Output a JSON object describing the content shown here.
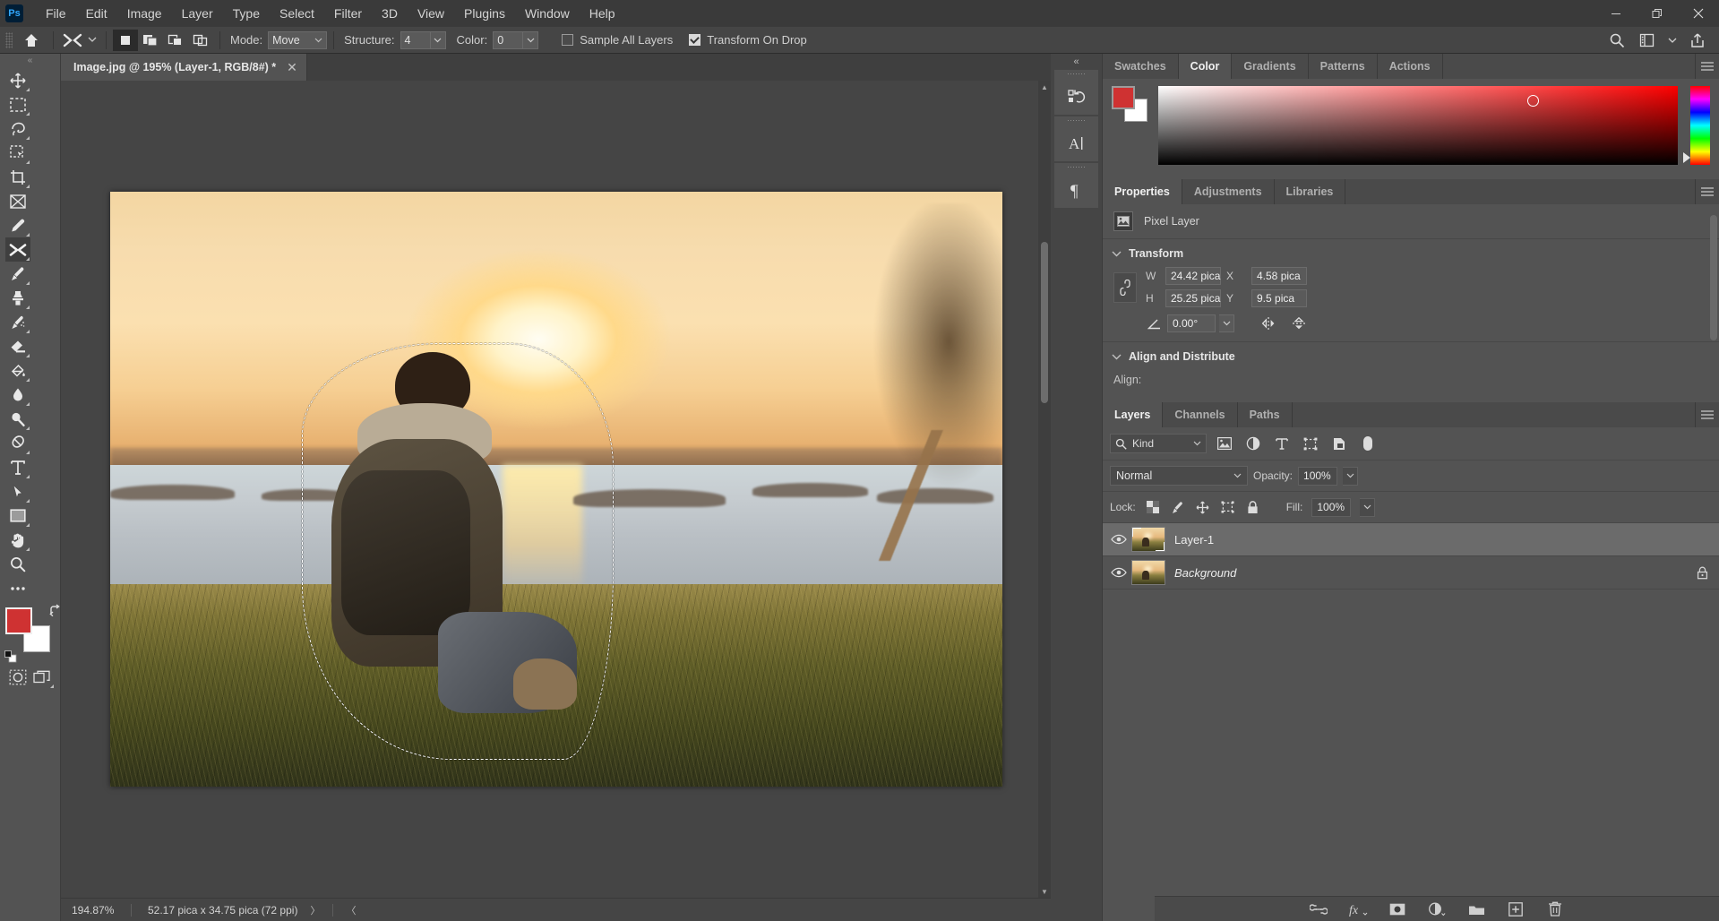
{
  "app": {
    "logo_text": "Ps",
    "menus": [
      "File",
      "Edit",
      "Image",
      "Layer",
      "Type",
      "Select",
      "Filter",
      "3D",
      "View",
      "Plugins",
      "Window",
      "Help"
    ],
    "window_controls": {
      "minimize": "minimize-icon",
      "maximize": "maximize-icon",
      "close": "close-icon"
    }
  },
  "options_bar": {
    "home_icon": "home-icon",
    "tool_icon": "shuffle-tool-icon",
    "selection_modes": [
      "new-selection",
      "add-to-selection",
      "subtract-from-selection",
      "intersect-selection"
    ],
    "mode_label": "Mode:",
    "mode_value": "Move",
    "structure_label": "Structure:",
    "structure_value": "4",
    "color_label": "Color:",
    "color_value": "0",
    "sample_all_layers_label": "Sample All Layers",
    "sample_all_layers_checked": false,
    "transform_on_drop_label": "Transform On Drop",
    "transform_on_drop_checked": true,
    "right_icons": [
      "search-icon",
      "workspace-icon",
      "chevron-down-icon",
      "share-icon"
    ]
  },
  "toolbar": {
    "tools": [
      {
        "name": "move-tool",
        "glyph": "move"
      },
      {
        "name": "rectangular-marquee-tool",
        "glyph": "marquee"
      },
      {
        "name": "lasso-tool",
        "glyph": "lasso"
      },
      {
        "name": "object-selection-tool",
        "glyph": "objsel"
      },
      {
        "name": "crop-tool",
        "glyph": "crop"
      },
      {
        "name": "frame-tool",
        "glyph": "frame"
      },
      {
        "name": "eyedropper-tool",
        "glyph": "eyedropper"
      },
      {
        "name": "content-aware-move-tool",
        "glyph": "shuffle",
        "active": true
      },
      {
        "name": "brush-tool",
        "glyph": "brush"
      },
      {
        "name": "clone-stamp-tool",
        "glyph": "stamp"
      },
      {
        "name": "history-brush-tool",
        "glyph": "historybrush"
      },
      {
        "name": "eraser-tool",
        "glyph": "eraser"
      },
      {
        "name": "gradient-tool",
        "glyph": "bucket"
      },
      {
        "name": "blur-tool",
        "glyph": "drop"
      },
      {
        "name": "dodge-tool",
        "glyph": "dodge"
      },
      {
        "name": "pen-tool",
        "glyph": "pen"
      },
      {
        "name": "horizontal-type-tool",
        "glyph": "type"
      },
      {
        "name": "path-selection-tool",
        "glyph": "arrow"
      },
      {
        "name": "rectangle-tool",
        "glyph": "rect"
      },
      {
        "name": "hand-tool",
        "glyph": "hand"
      },
      {
        "name": "zoom-tool",
        "glyph": "zoom"
      },
      {
        "name": "edit-toolbar-more",
        "glyph": "dots"
      }
    ],
    "foreground_color": "#cf3232",
    "background_color": "#ffffff",
    "quick_mask_icon": "quick-mask-icon",
    "screen_mode_icon": "screen-mode-icon"
  },
  "document": {
    "tab_title": "Image.jpg @ 195% (Layer-1, RGB/8#) *",
    "close_icon": "close-icon"
  },
  "status_bar": {
    "zoom": "194.87%",
    "dimensions": "52.17 pica x 34.75 pica (72 ppi)",
    "arrow_right": "chevron-right-icon",
    "arrow_left": "chevron-left-icon"
  },
  "vertical_strip": {
    "collapse_icon": "collapse-panels-icon",
    "items": [
      {
        "name": "history-panel-icon",
        "glyph": "history"
      },
      {
        "name": "character-panel-icon",
        "glyph": "char"
      },
      {
        "name": "paragraph-panel-icon",
        "glyph": "para"
      }
    ]
  },
  "color_panel": {
    "tabs": [
      "Swatches",
      "Color",
      "Gradients",
      "Patterns",
      "Actions"
    ],
    "active_tab": "Color",
    "menu_icon": "panel-menu-icon",
    "foreground_color": "#cf3232",
    "background_color": "#ffffff",
    "picker_marker_x_pct": 71,
    "picker_marker_y_pct": 11
  },
  "properties_panel": {
    "tabs": [
      "Properties",
      "Adjustments",
      "Libraries"
    ],
    "active_tab": "Properties",
    "menu_icon": "panel-menu-icon",
    "layer_kind": "Pixel Layer",
    "layer_kind_icon": "pixel-layer-icon",
    "transform": {
      "section_title": "Transform",
      "link_icon": "link-aspect-ratio-icon",
      "w_label": "W",
      "w_value": "24.42 pica",
      "h_label": "H",
      "h_value": "25.25 pica",
      "x_label": "X",
      "x_value": "4.58 pica",
      "y_label": "Y",
      "y_value": "9.5 pica",
      "angle_icon": "angle-icon",
      "angle_value": "0.00°",
      "flip_horizontal_icon": "flip-horizontal-icon",
      "flip_vertical_icon": "flip-vertical-icon"
    },
    "align": {
      "section_title": "Align and Distribute",
      "align_label": "Align:"
    }
  },
  "layers_panel": {
    "tabs": [
      "Layers",
      "Channels",
      "Paths"
    ],
    "active_tab": "Layers",
    "menu_icon": "panel-menu-icon",
    "filter": {
      "kind_label": "Kind",
      "search_icon": "search-icon",
      "filter_icons": [
        "pixel-filter-icon",
        "adjustment-filter-icon",
        "type-filter-icon",
        "shape-filter-icon",
        "smart-object-filter-icon",
        "filter-toggle-icon"
      ]
    },
    "blend_mode": "Normal",
    "opacity_label": "Opacity:",
    "opacity_value": "100%",
    "lock_label": "Lock:",
    "lock_icons": [
      "lock-transparent-pixels-icon",
      "lock-image-pixels-icon",
      "lock-position-icon",
      "lock-artboard-icon",
      "lock-all-icon"
    ],
    "fill_label": "Fill:",
    "fill_value": "100%",
    "layers": [
      {
        "name": "Layer-1",
        "visible": true,
        "selected": true,
        "italic": false,
        "locked": false
      },
      {
        "name": "Background",
        "visible": true,
        "selected": false,
        "italic": true,
        "locked": true
      }
    ],
    "bottom_icons": [
      "link-layers-icon",
      "layer-style-fx-icon",
      "add-layer-mask-icon",
      "new-fill-adjustment-layer-icon",
      "new-group-icon",
      "new-layer-icon",
      "delete-layer-icon"
    ],
    "fx_label": "fx"
  },
  "colors": {
    "app_bg": "#535353",
    "panel_bg": "#535353",
    "menu_bg": "#3a3a3a",
    "options_bg": "#454545",
    "canvas_bg": "#454545",
    "accent_red": "#cf3232",
    "text": "#c9c9c9",
    "selected_row": "#6b6b6b"
  }
}
